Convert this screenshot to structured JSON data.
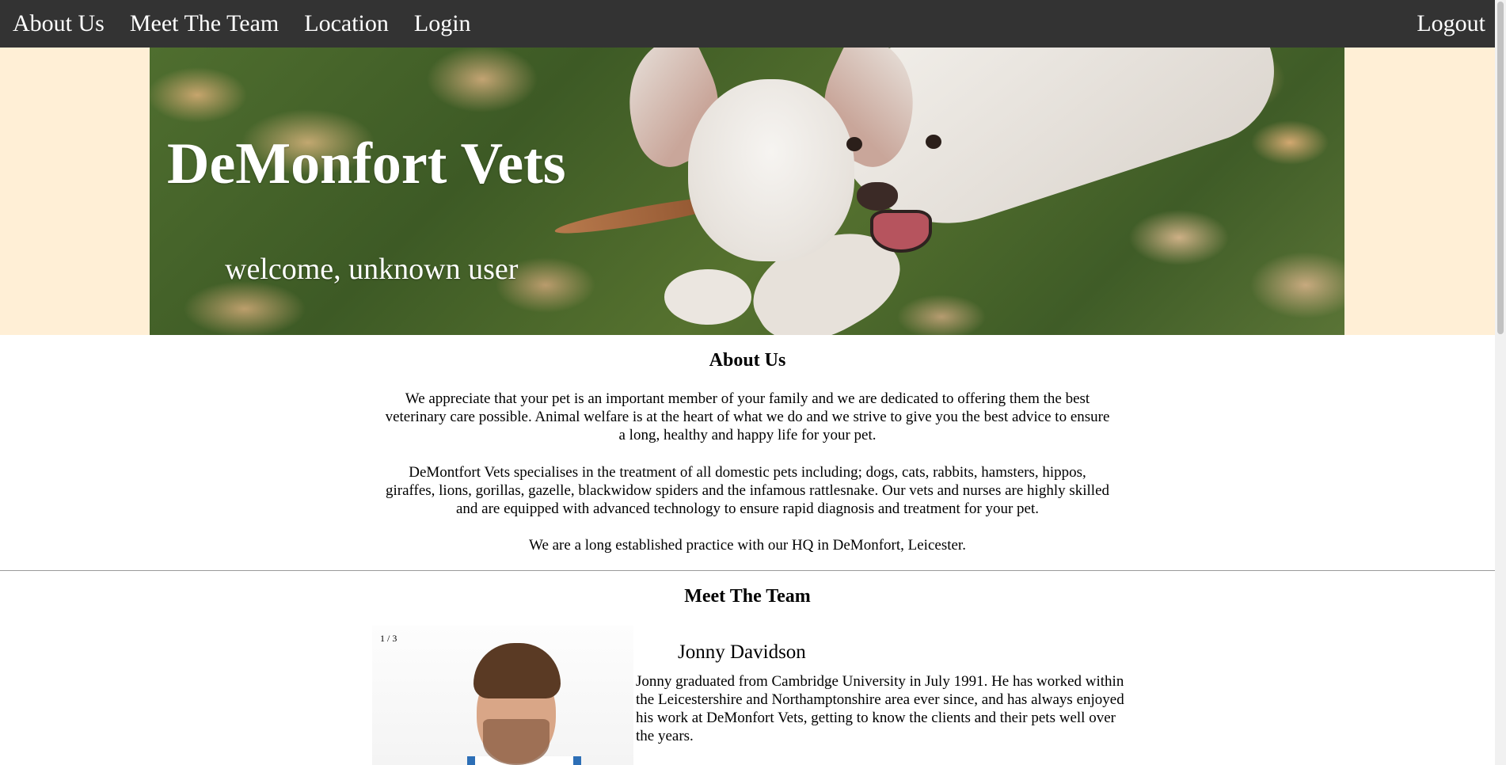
{
  "nav": {
    "items": [
      "About Us",
      "Meet The Team",
      "Location",
      "Login"
    ],
    "logout": "Logout"
  },
  "hero": {
    "title": "DeMonfort Vets",
    "welcome": "welcome, unknown user"
  },
  "about": {
    "heading": "About Us",
    "paragraphs": [
      "We appreciate that your pet is an important member of your family and we are dedicated to offering them the best veterinary care possible. Animal welfare is at the heart of what we do and we strive to give you the best advice to ensure a long, healthy and happy life for your pet.",
      "DeMontfort Vets specialises in the treatment of all domestic pets including; dogs, cats, rabbits, hamsters, hippos, giraffes, lions, gorillas, gazelle, blackwidow spiders and the infamous rattlesnake. Our vets and nurses are highly skilled and are equipped with advanced technology to ensure rapid diagnosis and treatment for your pet.",
      "We are a long established practice with our HQ in DeMonfort, Leicester."
    ]
  },
  "team": {
    "heading": "Meet The Team",
    "slide_counter": "1 / 3",
    "member": {
      "name": "Jonny Davidson",
      "bio": "Jonny graduated from Cambridge University in July 1991. He has worked within the Leicestershire and Northamptonshire area ever since, and has always enjoyed his work at DeMonfort Vets, getting to know the clients and their pets well over the years."
    }
  },
  "colors": {
    "nav_bg": "#333333",
    "hero_band": "#ffefd6",
    "divider": "#9a9a9a"
  }
}
